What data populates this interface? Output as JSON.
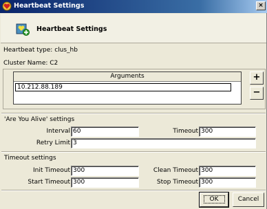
{
  "window": {
    "title": "Heartbeat Settings",
    "close_glyph": "×"
  },
  "header": {
    "title": "Heartbeat Settings"
  },
  "info": {
    "heartbeat_type": "Heartbeat type: clus_hb",
    "cluster_name": "Cluster Name: C2"
  },
  "arguments": {
    "column_header": "Arguments",
    "rows": [
      "10.212.88.189"
    ],
    "add_label": "+",
    "remove_label": "−"
  },
  "are_you_alive": {
    "section_title": "'Are You Alive' settings",
    "interval_label": "Interval",
    "interval_value": "60",
    "timeout_label": "Timeout",
    "timeout_value": "300",
    "retry_label": "Retry Limit",
    "retry_value": "3"
  },
  "timeout_settings": {
    "section_title": "Timeout settings",
    "init_label": "Init Timeout",
    "init_value": "300",
    "clean_label": "Clean Timeout",
    "clean_value": "300",
    "start_label": "Start Timeout",
    "start_value": "300",
    "stop_label": "Stop Timeout",
    "stop_value": "300"
  },
  "buttons": {
    "ok": "OK",
    "cancel": "Cancel"
  },
  "icons": {
    "title_icon": "heart-settings-icon",
    "header_icon": "heartbeat-add-icon"
  },
  "colors": {
    "title_bar": "#0a246a",
    "dialog_bg": "#ece9d8"
  }
}
